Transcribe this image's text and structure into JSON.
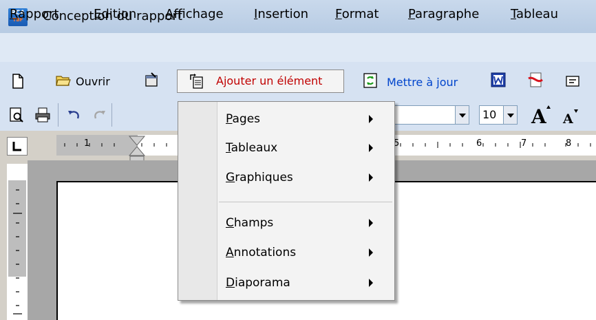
{
  "window": {
    "title": "Conception du rapport",
    "logo_text": "RCA",
    "logo_subtext": "TBF"
  },
  "menubar": {
    "items": [
      {
        "label": "Rapport"
      },
      {
        "label": "Edition"
      },
      {
        "label": "Affichage"
      },
      {
        "label": "Insertion"
      },
      {
        "label": "Format"
      },
      {
        "label": "Paragraphe"
      },
      {
        "label": "Tableau"
      }
    ]
  },
  "toolbar1": {
    "open_label": "Ouvrir",
    "add_element_label": "Ajouter un élément",
    "update_label": "Mettre à jour",
    "icons": [
      "new-document-icon",
      "open-folder-icon",
      "properties-icon",
      "add-element-icon",
      "refresh-icon",
      "word-export-icon",
      "pdf-export-icon",
      "mail-icon"
    ]
  },
  "toolbar2": {
    "font_size": "10",
    "icons": [
      "print-preview-icon",
      "print-icon",
      "undo-icon",
      "redo-icon",
      "grow-font-icon",
      "shrink-font-icon"
    ]
  },
  "ruler": {
    "numbers": [
      "1",
      "5",
      "6",
      "7",
      "8"
    ]
  },
  "dropdown": {
    "items": [
      {
        "label": "Pages"
      },
      {
        "label": "Tableaux"
      },
      {
        "label": "Graphiques"
      },
      {
        "label": "Champs"
      },
      {
        "label": "Annotations"
      },
      {
        "label": "Diaporama"
      }
    ]
  },
  "colors": {
    "menu_bg": "#dfe9f5",
    "toolbar_bg": "#d6e2f2",
    "add_element_text": "#c00000",
    "update_text": "#0044cc"
  }
}
